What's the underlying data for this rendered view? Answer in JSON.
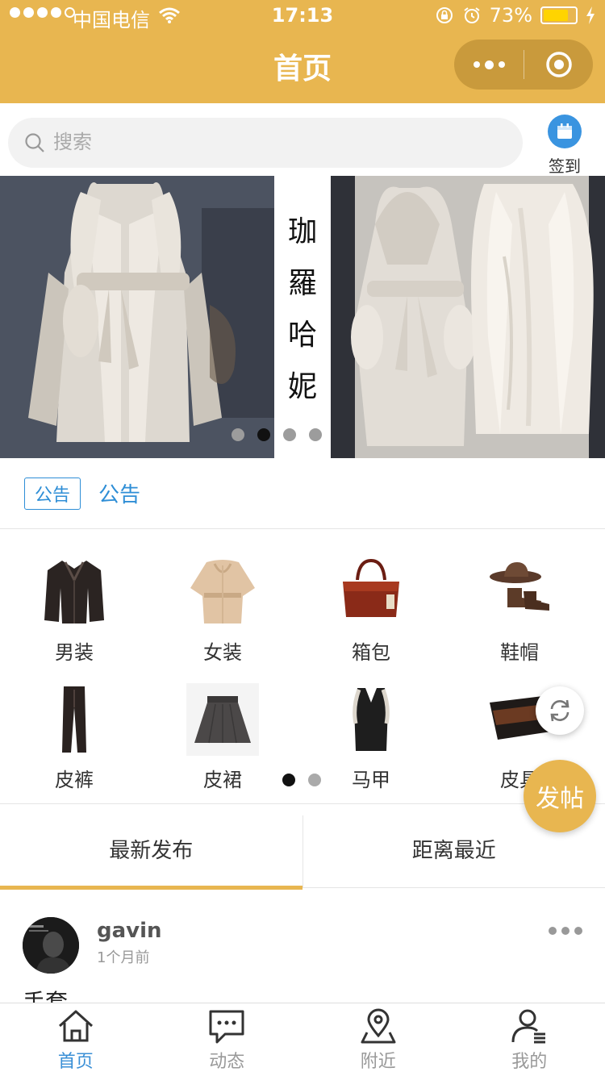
{
  "status_bar": {
    "carrier": "中国电信",
    "time": "17:13",
    "battery": "73%",
    "battery_level": 0.73
  },
  "nav": {
    "title": "首页",
    "more_icon": "more-dots-icon",
    "close_icon": "target-close-icon"
  },
  "search": {
    "placeholder": "搜索"
  },
  "signin": {
    "label": "签到",
    "icon": "calendar-icon"
  },
  "banner": {
    "strip_chars": [
      "珈",
      "羅",
      "哈",
      "妮"
    ],
    "slide_count": 4,
    "active_slide": 2
  },
  "notice": {
    "tag": "公告",
    "text": "公告"
  },
  "categories": {
    "items": [
      {
        "label": "男装",
        "icon": "leather-jacket-icon"
      },
      {
        "label": "女装",
        "icon": "fur-coat-icon"
      },
      {
        "label": "箱包",
        "icon": "handbag-icon"
      },
      {
        "label": "鞋帽",
        "icon": "boots-hat-icon"
      },
      {
        "label": "皮裤",
        "icon": "leather-pants-icon"
      },
      {
        "label": "皮裙",
        "icon": "leather-skirt-icon"
      },
      {
        "label": "马甲",
        "icon": "vest-icon"
      },
      {
        "label": "皮具",
        "icon": "wallet-icon"
      }
    ],
    "page_count": 2,
    "active_page": 1
  },
  "fab": {
    "refresh_icon": "refresh-icon",
    "post_label": "发帖"
  },
  "feed_tabs": [
    {
      "label": "最新发布",
      "active": true
    },
    {
      "label": "距离最近",
      "active": false
    }
  ],
  "post": {
    "username": "gavin",
    "time": "1个月前",
    "content": "手套",
    "menu_icon": "more-dots-icon"
  },
  "tabbar": [
    {
      "label": "首页",
      "icon": "home-icon",
      "active": true
    },
    {
      "label": "动态",
      "icon": "chat-bubble-icon",
      "active": false
    },
    {
      "label": "附近",
      "icon": "location-pin-icon",
      "active": false
    },
    {
      "label": "我的",
      "icon": "user-icon",
      "active": false
    }
  ],
  "colors": {
    "brand": "#e8b650",
    "link": "#2e8ed6",
    "tab_active": "#3a8fd6"
  }
}
